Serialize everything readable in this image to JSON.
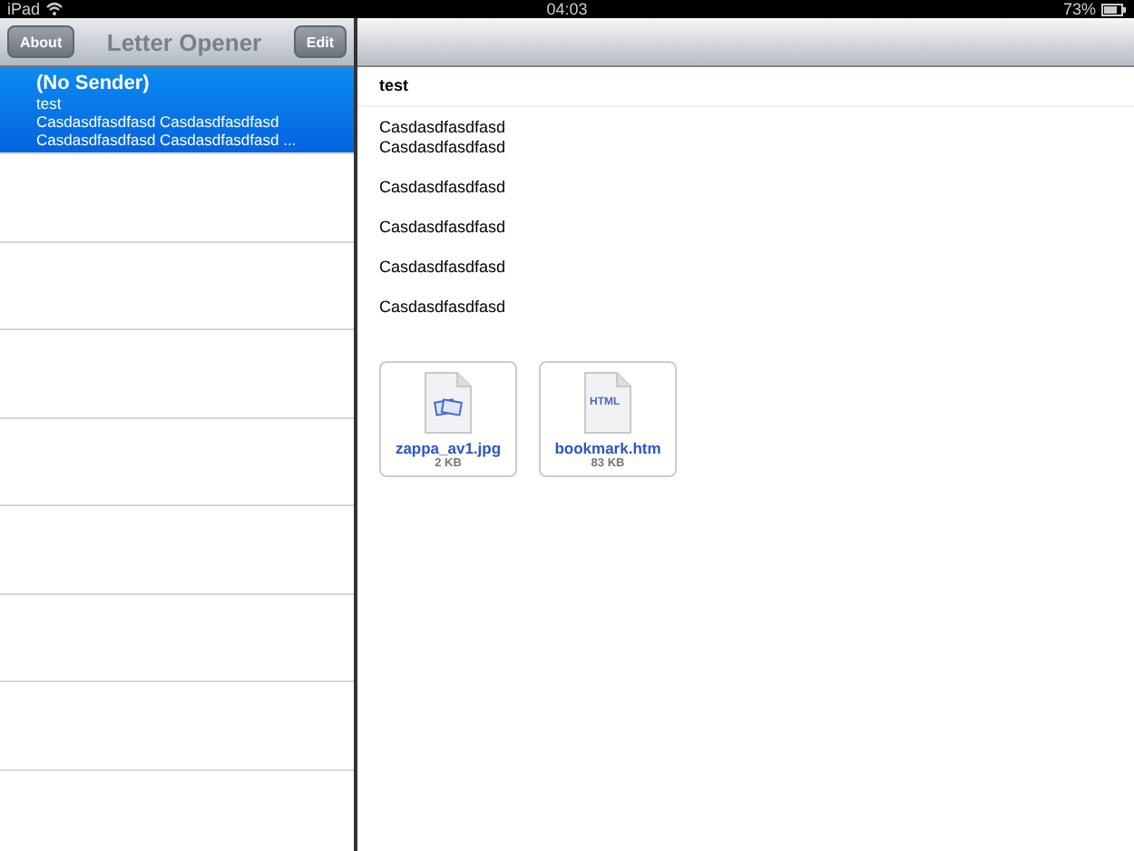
{
  "status_bar": {
    "device": "iPad",
    "time": "04:03",
    "battery": "73%"
  },
  "master": {
    "title": "Letter Opener",
    "left_button": "About",
    "right_button": "Edit"
  },
  "messages": [
    {
      "sender": "(No Sender)",
      "subject": "test",
      "preview": [
        "Casdasdfasdfasd Casdasdfasdfasd",
        "Casdasdfasdfasd Casdasdfasdfasd ..."
      ],
      "selected": true
    }
  ],
  "detail": {
    "subject": "test",
    "body": [
      [
        "Casdasdfasdfasd",
        "Casdasdfasdfasd"
      ],
      [
        "Casdasdfasdfasd"
      ],
      [
        "Casdasdfasdfasd"
      ],
      [
        "Casdasdfasdfasd"
      ],
      [
        "Casdasdfasdfasd"
      ]
    ],
    "attachments": [
      {
        "kind": "image",
        "name": "zappa_av1.jpg",
        "size": "2 KB"
      },
      {
        "kind": "html",
        "name": "bookmark.htm",
        "size": "83 KB",
        "icon_text": "HTML"
      }
    ]
  }
}
